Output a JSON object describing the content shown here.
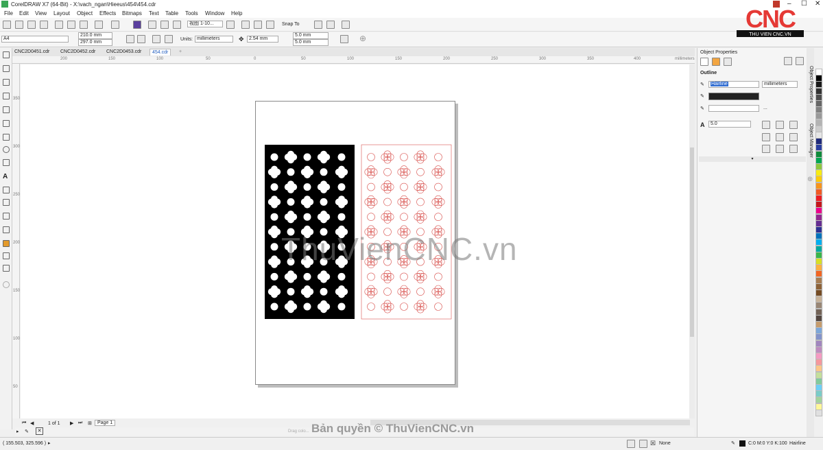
{
  "window": {
    "title": "CorelDRAW X7 (64-Bit) - X:\\vach_ngan\\Hieeus\\454\\454.cdr"
  },
  "menu": [
    "File",
    "Edit",
    "View",
    "Layout",
    "Object",
    "Effects",
    "Bitmaps",
    "Text",
    "Table",
    "Tools",
    "Window",
    "Help"
  ],
  "toolbar": {
    "zoom": "视图 1-10...",
    "snap_label": "Snap To"
  },
  "properties": {
    "page_size": "A4",
    "width": "210.0 mm",
    "height": "297.0 mm",
    "units_label": "Units:",
    "units": "millimeters",
    "nudge": "2.54 mm",
    "dup_x": "5.0 mm",
    "dup_y": "5.0 mm"
  },
  "tabs": [
    {
      "label": "CNC2D0451.cdr"
    },
    {
      "label": "CNC2D0452.cdr"
    },
    {
      "label": "CNC2D0453.cdr"
    },
    {
      "label": "454.cdr"
    }
  ],
  "ruler": {
    "top": [
      "200",
      "150",
      "100",
      "50",
      "0",
      "50",
      "100",
      "150",
      "200",
      "250",
      "300",
      "350",
      "400"
    ],
    "left": [
      "350",
      "300",
      "250",
      "200",
      "150",
      "100",
      "50"
    ],
    "units": "millimeters"
  },
  "pagenav": {
    "counter": "1 of 1",
    "page_tab": "Page 1"
  },
  "colorbar": {
    "hint": "Drag colo..."
  },
  "panel": {
    "title": "Object Properties",
    "section": "Outline",
    "width": "Hairline",
    "units": "millimeters",
    "miter": "5.0",
    "side_tabs": [
      "Object Properties",
      "Object Manager"
    ]
  },
  "status": {
    "coords": "( 155.503, 325.596 )",
    "fill": "None",
    "outline_color": "C:0 M:0 Y:0 K:100",
    "outline_width": "Hairline"
  },
  "watermark": {
    "main": "ThuVienCNC.vn",
    "copyright": "Bản quyền © ThuVienCNC.vn"
  },
  "logo": {
    "mark": "CNC",
    "caption": "THU VIEN CNC.VN"
  },
  "colors": {
    "accent_red": "#e53935",
    "outline_red": "#d9534f",
    "fill_black": "#000000"
  },
  "palette": [
    "#ffffff",
    "#000000",
    "#1a1a1a",
    "#333333",
    "#4d4d4d",
    "#666666",
    "#808080",
    "#999999",
    "#b3b3b3",
    "#cccccc",
    "#e6e6e6",
    "#1f2a7a",
    "#2a3fa0",
    "#0e8a3a",
    "#00a651",
    "#8dc63f",
    "#f7ec13",
    "#ffcb05",
    "#f7941d",
    "#f15a24",
    "#ed1c24",
    "#c4161c",
    "#ec008c",
    "#92278f",
    "#662d91",
    "#2e3192",
    "#0072bc",
    "#00aeef",
    "#00a99d",
    "#39b54a",
    "#d7df23",
    "#fbb040",
    "#f26522",
    "#a67c52",
    "#8c6239",
    "#754c24",
    "#c7b299",
    "#998675",
    "#736357",
    "#534741",
    "#c69c6d",
    "#7da7d9",
    "#8393ca",
    "#a186be",
    "#bd8cbf",
    "#f49ac2",
    "#f5989d",
    "#fdc689",
    "#c4df9b",
    "#82ca9c",
    "#6dcff6",
    "#7accc8",
    "#a3d39c",
    "#fff799",
    "#e0e0e0"
  ]
}
